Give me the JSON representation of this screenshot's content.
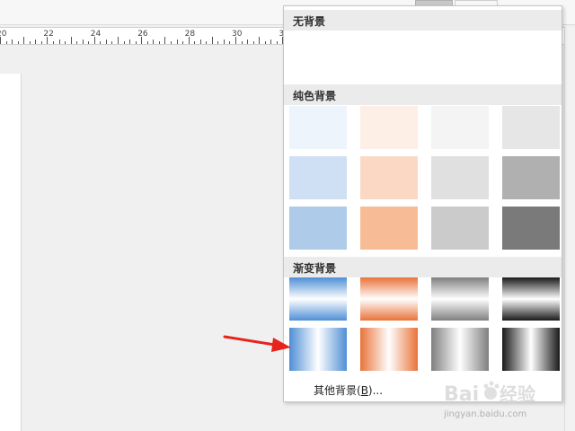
{
  "ruler": {
    "numbers": [
      "20",
      "22",
      "24",
      "26",
      "28",
      "30",
      "32"
    ]
  },
  "panel": {
    "no_background_label": "无背景",
    "solid_label": "纯色背景",
    "gradient_label": "渐变背景",
    "more_label": "其他背景(B)...",
    "more_mnemonic": "B"
  },
  "solid_colors": [
    [
      "#eef4fc",
      "#fdeee6",
      "#f4f4f4",
      "#e6e6e6"
    ],
    [
      "#cfe0f4",
      "#fbd8c4",
      "#e0e0e0",
      "#b0b0b0"
    ],
    [
      "#aecbea",
      "#f7bc95",
      "#cbcbcb",
      "#7a7a7a"
    ]
  ],
  "gradient_colors": [
    "#4f8fd6",
    "#e9733a",
    "#7f7f7f",
    "#1a1a1a"
  ],
  "watermark": {
    "brand": "Baidu经验",
    "url": "jingyan.baidu.com"
  },
  "colors": {
    "arrow": "#e8231c",
    "header_bg": "#ebebeb"
  }
}
